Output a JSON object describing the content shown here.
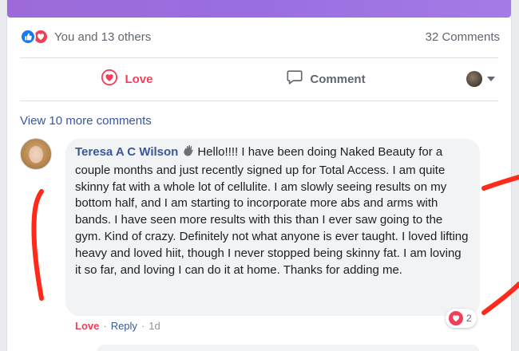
{
  "reactions": {
    "icons": [
      "like-icon",
      "love-icon"
    ],
    "summary": "You and 13 others",
    "comments_count": "32 Comments"
  },
  "actions": {
    "love_label": "Love",
    "comment_label": "Comment"
  },
  "comments": {
    "view_more": "View 10 more comments",
    "items": [
      {
        "author": "Teresa A C Wilson",
        "text": "Hello!!!! I have been doing Naked Beauty for a couple months and just recently signed up for Total Access. I am quite skinny fat with a whole lot of cellulite. I am slowly seeing results on my bottom half, and I am starting to incorporate more abs and arms with bands. I have seen more results with this than I ever saw going to the gym. Kind of crazy. Definitely not what anyone is ever taught. I loved lifting heavy and loved hiit, though I never stopped being skinny fat. I am loving it so far, and loving I can do it at home. Thanks for adding me.",
        "reaction_count": "2",
        "love_label": "Love",
        "reply_label": "Reply",
        "separator": "·",
        "time": "1d"
      }
    ]
  },
  "colors": {
    "love_red": "#f33e58",
    "link_blue": "#385898",
    "annotation_red": "#ff2a1a",
    "banner_purple": "#9c6bd9"
  }
}
